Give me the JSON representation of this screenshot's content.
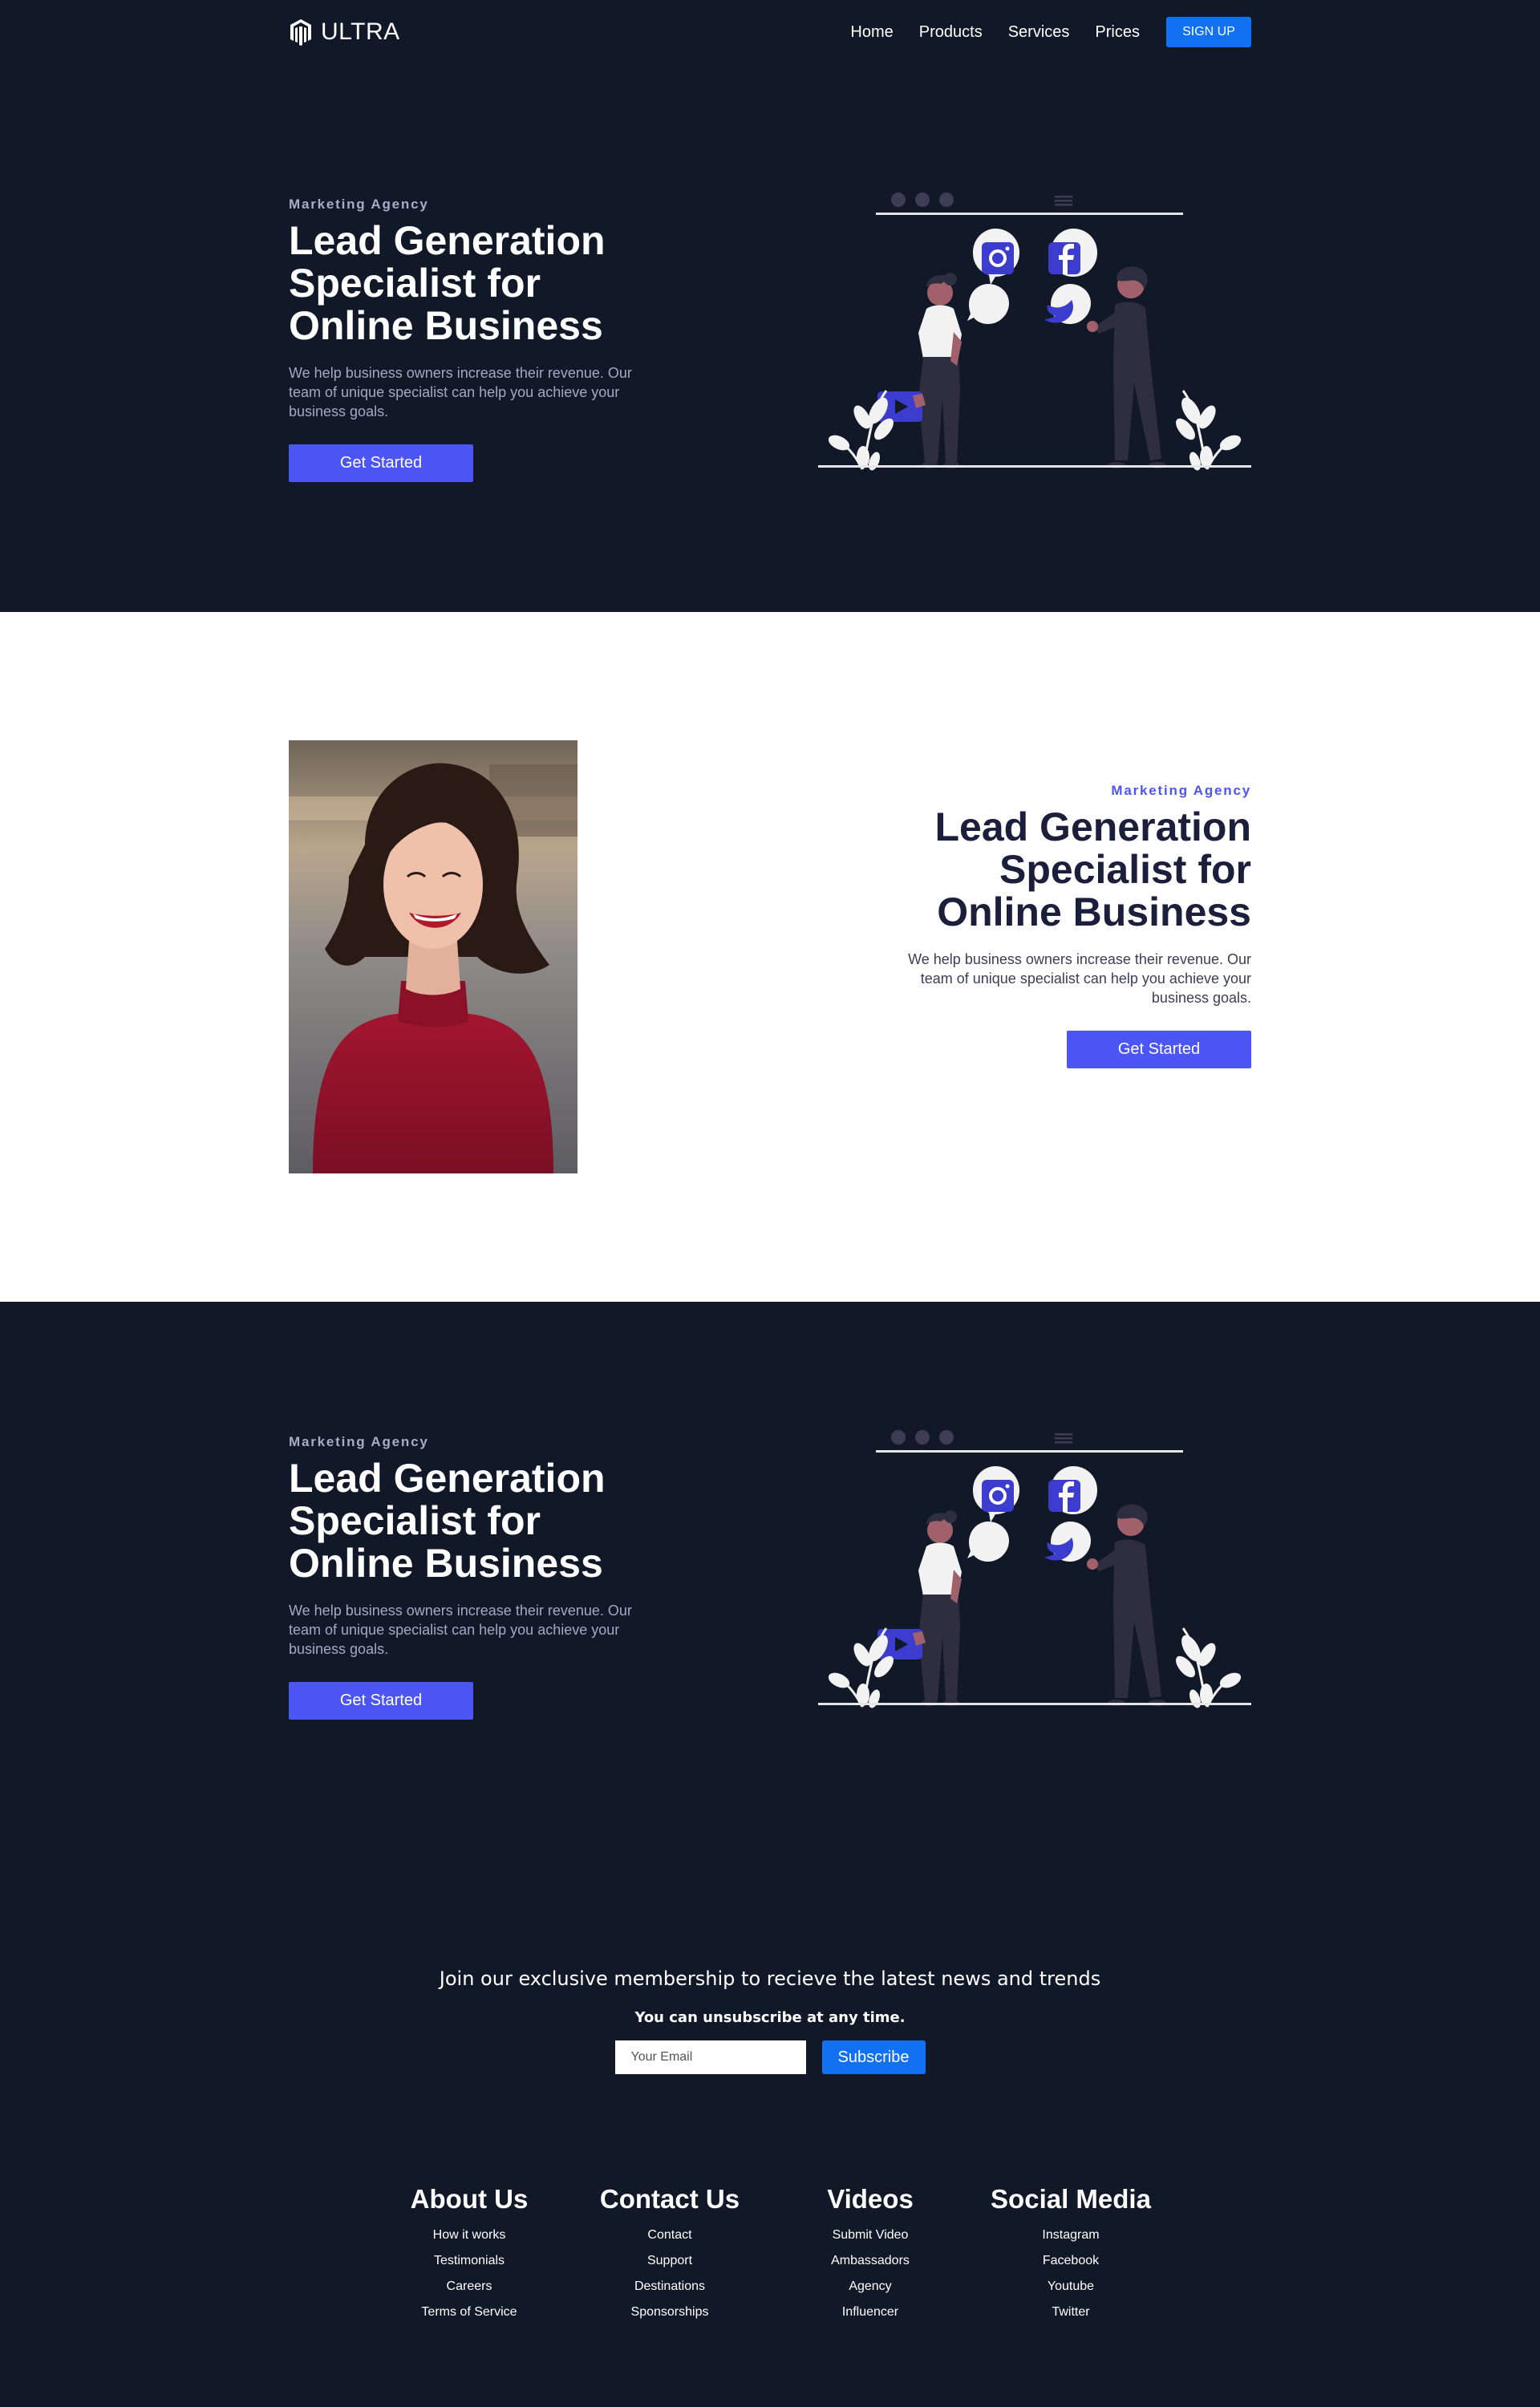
{
  "nav": {
    "brand": "ULTRA",
    "links": [
      "Home",
      "Products",
      "Services",
      "Prices"
    ],
    "signup": "SIGN UP"
  },
  "hero1": {
    "eyebrow": "Marketing Agency",
    "headline": "Lead Generation Specialist for Online Business",
    "desc": "We help business owners increase their revenue. Our team of unique specialist can help you achieve your business goals.",
    "cta": "Get Started"
  },
  "hero2": {
    "eyebrow": "Marketing Agency",
    "headline": "Lead Generation Specialist for Online Business",
    "desc": "We help business owners increase their revenue. Our team of unique specialist can help you achieve your business goals.",
    "cta": "Get Started"
  },
  "hero3": {
    "eyebrow": "Marketing Agency",
    "headline": "Lead Generation Specialist for Online Business",
    "desc": "We help business owners increase their revenue. Our team of unique specialist can help you achieve your business goals.",
    "cta": "Get Started"
  },
  "newsletter": {
    "title": "Join our exclusive membership to recieve the latest news and trends",
    "subtitle": "You can unsubscribe at any time.",
    "placeholder": "Your Email",
    "button": "Subscribe"
  },
  "footer": {
    "columns": [
      {
        "title": "About Us",
        "links": [
          "How it works",
          "Testimonials",
          "Careers",
          "Terms of Service"
        ]
      },
      {
        "title": "Contact Us",
        "links": [
          "Contact",
          "Support",
          "Destinations",
          "Sponsorships"
        ]
      },
      {
        "title": "Videos",
        "links": [
          "Submit Video",
          "Ambassadors",
          "Agency",
          "Influencer"
        ]
      },
      {
        "title": "Social Media",
        "links": [
          "Instagram",
          "Facebook",
          "Youtube",
          "Twitter"
        ]
      }
    ]
  },
  "colors": {
    "dark_bg": "#111827",
    "accent": "#4c56f5",
    "signup_blue": "#1271f0"
  }
}
